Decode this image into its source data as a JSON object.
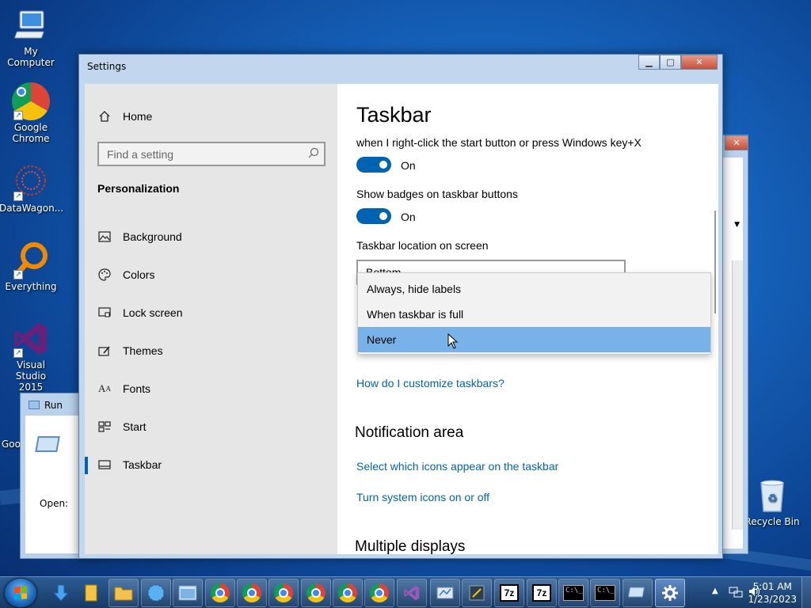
{
  "desktop": {
    "icons": [
      {
        "label": "My Computer",
        "icon": "computer-icon"
      },
      {
        "label": "Google Chrome",
        "icon": "chrome-icon"
      },
      {
        "label": "DataWagon...",
        "icon": "datawagon-icon"
      },
      {
        "label": "Everything",
        "icon": "everything-search-icon"
      },
      {
        "label": "Visual Studio 2015",
        "icon": "visual-studio-icon"
      },
      {
        "label": "Goo",
        "icon": "shortcut-icon"
      },
      {
        "label": "Recycle Bin",
        "icon": "recycle-bin-icon"
      }
    ]
  },
  "run_dialog": {
    "title": "Run",
    "open_label": "Open:"
  },
  "settings": {
    "window_title": "Settings",
    "nav": {
      "home": "Home",
      "search_placeholder": "Find a setting",
      "section": "Personalization",
      "items": [
        {
          "label": "Background",
          "icon": "picture-icon"
        },
        {
          "label": "Colors",
          "icon": "palette-icon"
        },
        {
          "label": "Lock screen",
          "icon": "lock-screen-icon"
        },
        {
          "label": "Themes",
          "icon": "themes-icon"
        },
        {
          "label": "Fonts",
          "icon": "fonts-icon"
        },
        {
          "label": "Start",
          "icon": "start-icon"
        },
        {
          "label": "Taskbar",
          "icon": "taskbar-icon",
          "active": true
        }
      ]
    },
    "content": {
      "title": "Taskbar",
      "winx_label": "when I right-click the start button or press Windows key+X",
      "winx_toggle": "On",
      "badges_label": "Show badges on taskbar buttons",
      "badges_toggle": "On",
      "location_label": "Taskbar location on screen",
      "location_value": "Bottom",
      "combine_options": [
        "Always, hide labels",
        "When taskbar is full",
        "Never"
      ],
      "combine_selected": "Never",
      "customize_link": "How do I customize taskbars?",
      "notification_heading": "Notification area",
      "notification_link1": "Select which icons appear on the taskbar",
      "notification_link2": "Turn system icons on or off",
      "multiple_displays_heading": "Multiple displays"
    }
  },
  "taskbar": {
    "clock_time": "5:01 AM",
    "clock_date": "1/23/2023",
    "sevenzip_label": "7z",
    "accent": "#0063b1",
    "selected_bg": "#78b2e8"
  }
}
